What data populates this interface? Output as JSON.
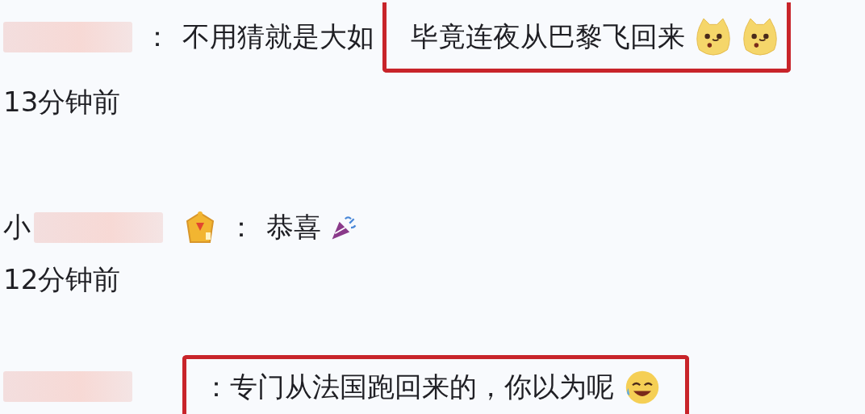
{
  "comments": [
    {
      "body": [
        {
          "highlighted": false,
          "text": "："
        },
        {
          "highlighted": false,
          "text": "不用猜就是大如"
        },
        {
          "highlighted": true,
          "text": "毕竟连夜从巴黎飞回来",
          "emojis": [
            {
              "kind": "dog"
            },
            {
              "kind": "dog"
            }
          ]
        }
      ],
      "time": "13分钟前"
    },
    {
      "name_prefix": "小",
      "badge": true,
      "body": [
        {
          "highlighted": false,
          "text": "："
        },
        {
          "highlighted": false,
          "text": "恭喜",
          "emojis": [
            {
              "kind": "party"
            }
          ]
        }
      ],
      "time": "12分钟前"
    },
    {
      "body": [
        {
          "highlighted": true,
          "text": "：专门从法国跑回来的，你以为呢",
          "emojis": [
            {
              "kind": "laugh"
            }
          ]
        }
      ]
    }
  ]
}
